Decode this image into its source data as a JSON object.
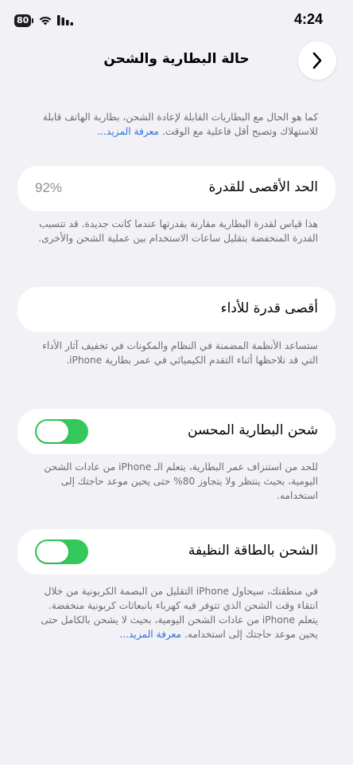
{
  "status_bar": {
    "battery_level": "80",
    "time": "4:24"
  },
  "nav": {
    "title": "حالة البطارية والشحن",
    "back_icon": "chevron-right-icon"
  },
  "intro": {
    "text": "كما هو الحال مع البطاريات القابلة لإعادة الشحن، بطارية الهاتف قابلة للاستهلاك وتصبح أقل فاعلية مع الوقت.",
    "link": "معرفة المزيد..."
  },
  "max_capacity": {
    "label": "الحد الأقصى للقدرة",
    "value": "92%",
    "footer": "هذا قياس لقدرة البطارية مقارنة بقدرتها عندما كانت جديدة. قد تتسبب القدرة المنخفضة بتقليل ساعات الاستخدام بين عملية الشحن والأخرى."
  },
  "peak_performance": {
    "label": "أقصى قدرة للأداء",
    "footer": "ستساعد الأنظمة المضمنة في النظام والمكونات في تخفيف آثار الأداء التي قد تلاحظها أثناء التقدم الكيميائي في عمر بطارية iPhone."
  },
  "optimized_charging": {
    "label": "شحن البطارية المحسن",
    "enabled": true,
    "footer": "للحد من استنزاف عمر البطارية، يتعلم الـ iPhone من عادات الشحن اليومية، بحيث ينتظر ولا يتجاوز 80% حتى يحين موعد حاجتك إلى استخدامه."
  },
  "clean_energy": {
    "label": "الشحن بالطاقة النظيفة",
    "enabled": true,
    "footer": "في منطقتك، سيحاول iPhone التقليل من البصمة الكربونية من خلال انتقاء وقت الشحن الذي تتوفر فيه كهرباء بانبعاثات كربونية منخفضة. يتعلم iPhone من عادات الشحن اليومية، بحيث لا يشحن بالكامل حتى يحين موعد حاجتك إلى استخدامه.",
    "link": "معرفة المزيد..."
  },
  "colors": {
    "background": "#f2f2f6",
    "toggle_on": "#34c759",
    "link": "#2f6fe0",
    "secondary_text": "#6c6c70"
  }
}
